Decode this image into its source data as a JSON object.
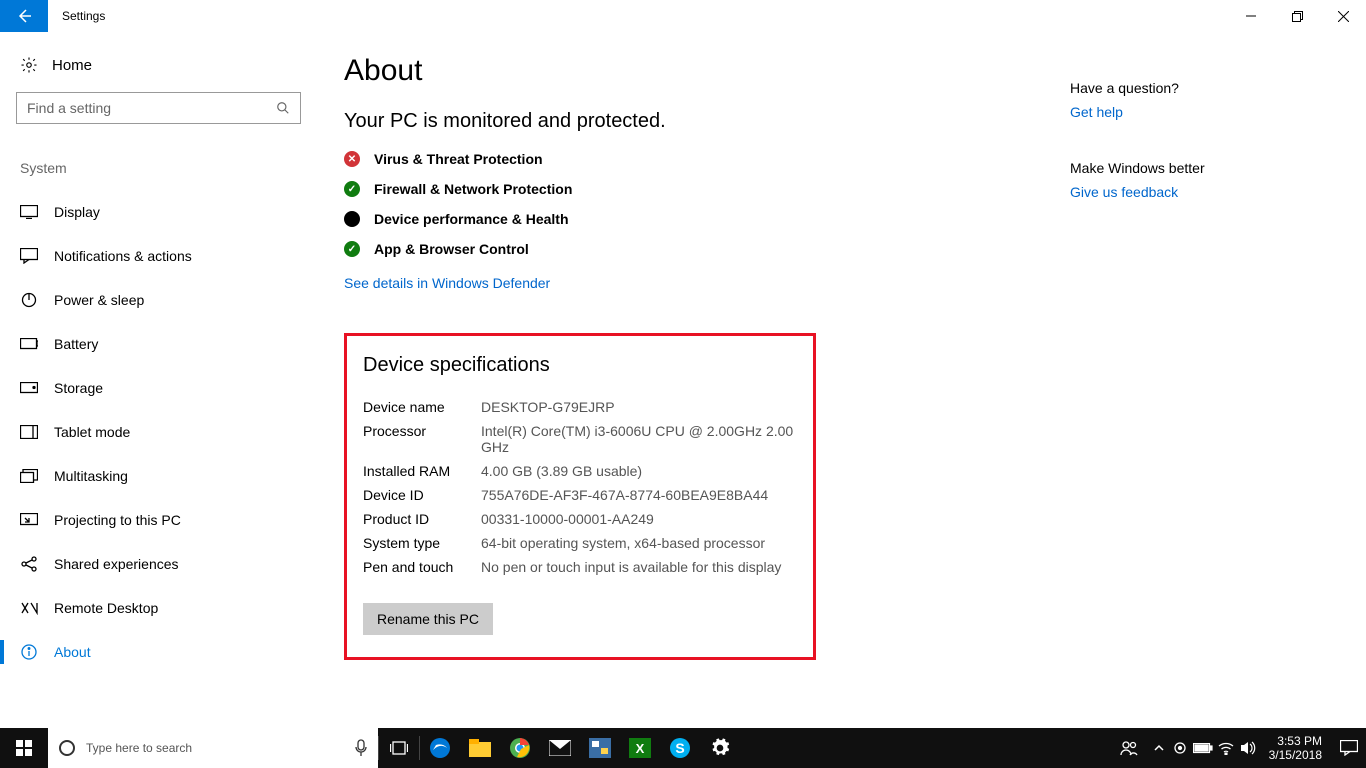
{
  "window": {
    "title": "Settings"
  },
  "sidebar": {
    "home": "Home",
    "search_placeholder": "Find a setting",
    "category": "System",
    "items": [
      "Display",
      "Notifications & actions",
      "Power & sleep",
      "Battery",
      "Storage",
      "Tablet mode",
      "Multitasking",
      "Projecting to this PC",
      "Shared experiences",
      "Remote Desktop",
      "About"
    ]
  },
  "main": {
    "heading": "About",
    "protected_heading": "Your PC is monitored and protected.",
    "protection": [
      "Virus & Threat Protection",
      "Firewall & Network Protection",
      "Device performance & Health",
      "App & Browser Control"
    ],
    "defender_link": "See details in Windows Defender",
    "spec_heading": "Device specifications",
    "specs": {
      "device_name_k": "Device name",
      "device_name_v": "DESKTOP-G79EJRP",
      "processor_k": "Processor",
      "processor_v": "Intel(R) Core(TM) i3-6006U CPU @ 2.00GHz   2.00 GHz",
      "ram_k": "Installed RAM",
      "ram_v": "4.00 GB (3.89 GB usable)",
      "device_id_k": "Device ID",
      "device_id_v": "755A76DE-AF3F-467A-8774-60BEA9E8BA44",
      "product_id_k": "Product ID",
      "product_id_v": "00331-10000-00001-AA249",
      "system_type_k": "System type",
      "system_type_v": "64-bit operating system, x64-based processor",
      "pen_k": "Pen and touch",
      "pen_v": "No pen or touch input is available for this display"
    },
    "rename_button": "Rename this PC"
  },
  "aside": {
    "question": "Have a question?",
    "get_help": "Get help",
    "better": "Make Windows better",
    "feedback": "Give us feedback"
  },
  "taskbar": {
    "search_placeholder": "Type here to search",
    "time": "3:53 PM",
    "date": "3/15/2018"
  }
}
